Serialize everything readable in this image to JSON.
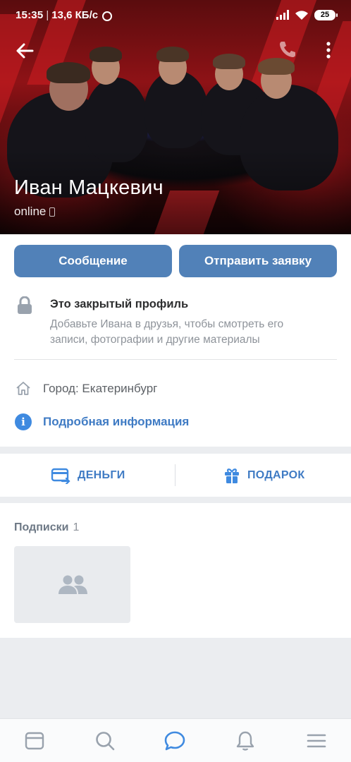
{
  "status_bar": {
    "time": "15:35",
    "speed": "13,6 КБ/с",
    "battery": "25"
  },
  "profile": {
    "name": "Иван Мацкевич",
    "status": "online"
  },
  "actions": {
    "message_label": "Сообщение",
    "request_label": "Отправить заявку"
  },
  "privacy": {
    "title": "Это закрытый профиль",
    "description": "Добавьте Ивана в друзья, чтобы смотреть его записи, фотографии и другие материалы"
  },
  "info": {
    "city": "Город: Екатеринбург",
    "details_link": "Подробная информация"
  },
  "extras": {
    "money_label": "ДЕНЬГИ",
    "gift_label": "ПОДАРОК"
  },
  "subscriptions": {
    "title": "Подписки",
    "count": "1"
  },
  "colors": {
    "accent": "#5181b8",
    "link": "#3f7bc4",
    "active_nav": "#3f8ae0",
    "inactive_nav": "#99a2ad"
  },
  "icons": [
    "back-arrow-icon",
    "phone-icon",
    "more-vertical-icon",
    "lock-icon",
    "home-icon",
    "info-icon",
    "money-transfer-icon",
    "gift-icon",
    "users-icon",
    "feed-icon",
    "search-icon",
    "messages-icon",
    "notifications-icon",
    "menu-icon"
  ]
}
